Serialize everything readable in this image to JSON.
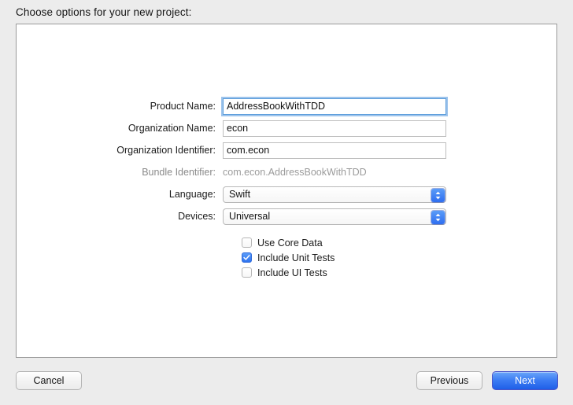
{
  "sheet": {
    "title": "Choose options for your new project:"
  },
  "form": {
    "fields": [
      {
        "label": "Product Name:",
        "value": "AddressBookWithTDD",
        "placeholder": "",
        "type": "text",
        "focused": true
      },
      {
        "label": "Organization Name:",
        "value": "econ",
        "placeholder": "",
        "type": "text",
        "focused": false
      },
      {
        "label": "Organization Identifier:",
        "value": "com.econ",
        "placeholder": "",
        "type": "text",
        "focused": false
      },
      {
        "label": "Bundle Identifier:",
        "value": "com.econ.AddressBookWithTDD",
        "type": "static"
      },
      {
        "label": "Language:",
        "value": "Swift",
        "type": "popup"
      },
      {
        "label": "Devices:",
        "value": "Universal",
        "type": "popup"
      }
    ],
    "checkboxes": [
      {
        "label": "Use Core Data",
        "checked": false
      },
      {
        "label": "Include Unit Tests",
        "checked": true
      },
      {
        "label": "Include UI Tests",
        "checked": false
      }
    ]
  },
  "buttons": {
    "cancel": "Cancel",
    "previous": "Previous",
    "next": "Next"
  },
  "colors": {
    "window_background": "#ececec",
    "panel_background": "#ffffff",
    "accent_blue": "#3c7cf3",
    "focus_ring": "#6aa5e2",
    "disabled_text": "#9b9b9b"
  }
}
